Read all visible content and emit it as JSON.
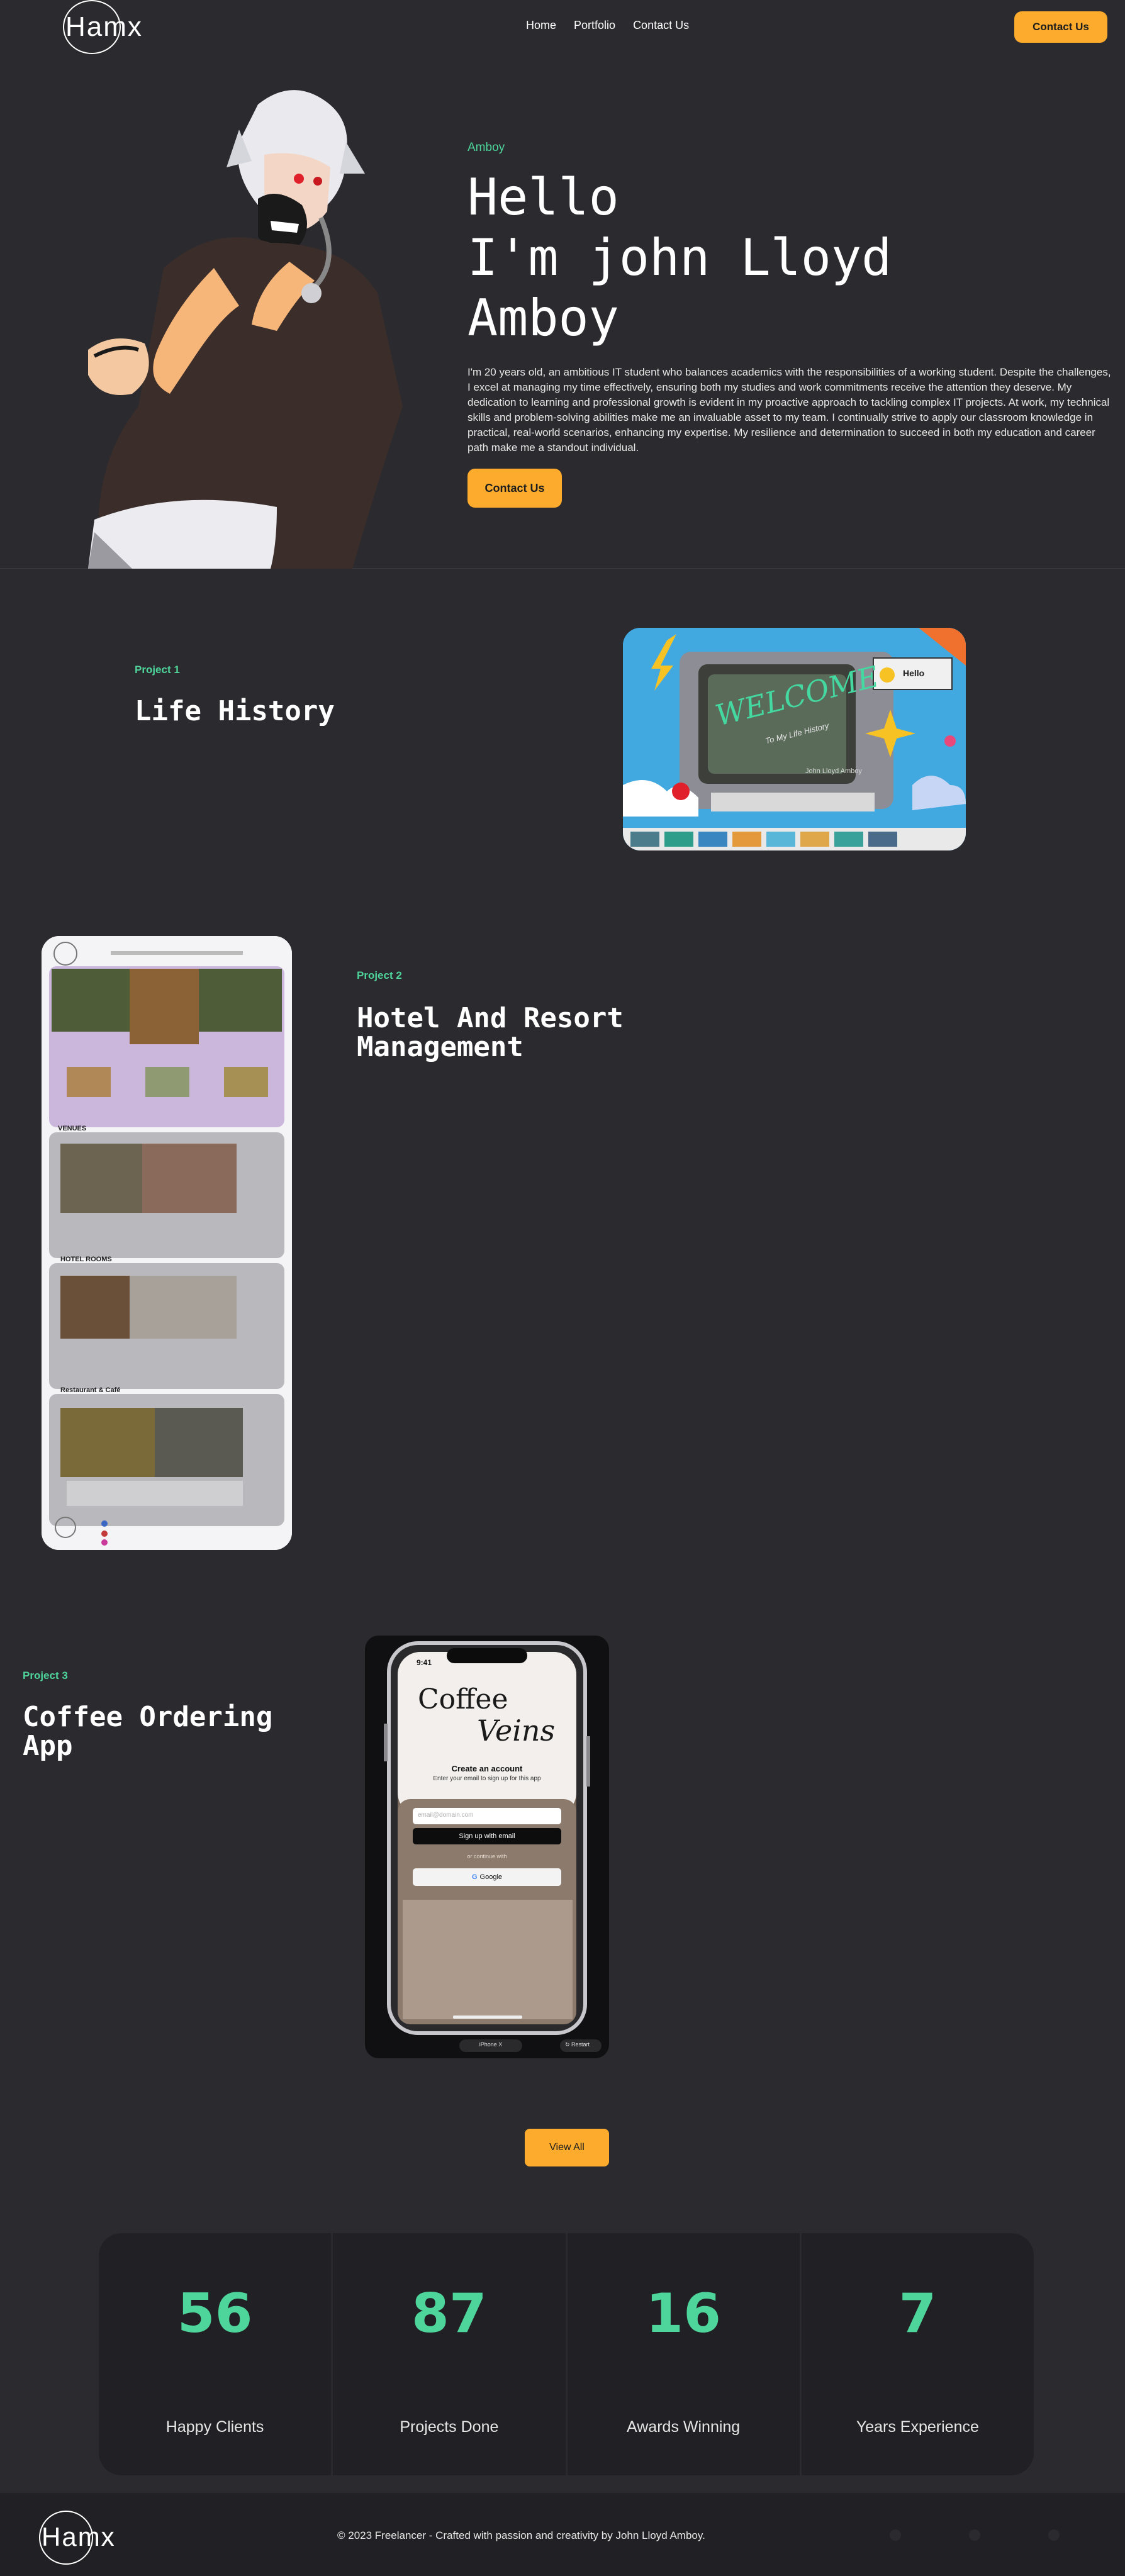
{
  "nav": {
    "logo_text": "Hamx",
    "links": [
      "Home",
      "Portfolio",
      "Contact Us"
    ],
    "cta": "Contact Us"
  },
  "hero": {
    "subtitle": "Amboy",
    "title_lines": [
      "Hello",
      "I'm john Lloyd",
      "Amboy"
    ],
    "description": "I'm 20 years old, an ambitious IT student who balances academics with the responsibilities of a working student. Despite the challenges, I excel at managing my time effectively, ensuring both my studies and work commitments receive the attention they deserve. My dedication to learning and professional growth is evident in my proactive approach to tackling complex IT projects. At work, my technical skills and problem-solving abilities make me an invaluable asset to my team. I continually strive to apply our classroom knowledge in practical, real-world scenarios, enhancing my expertise. My resilience and determination to succeed in both my education and career path make me a standout individual.",
    "cta": "Contact Us"
  },
  "projects": [
    {
      "tag": "Project 1",
      "title": "Life History",
      "screen_text": "WELCOME",
      "screen_sub": "To My Life History",
      "screen_name": "John Lloyd Amboy",
      "popup": "Hello"
    },
    {
      "tag": "Project 2",
      "title": "Hotel And Resort Management",
      "sections": [
        "VENUES",
        "HOTEL ROOMS",
        "Restaurant & Café"
      ]
    },
    {
      "tag": "Project 3",
      "title": "Coffee Ordering App",
      "app_name_1": "Coffee",
      "app_name_2": "Veins",
      "time": "9:41",
      "heading": "Create an account",
      "sub": "Enter your email to sign up for this app",
      "email_placeholder": "email@domain.com",
      "signup": "Sign up with email",
      "or": "or continue with",
      "google": "Google",
      "device": "iPhone X",
      "restart": "Restart"
    }
  ],
  "view_all": "View All",
  "stats": [
    {
      "value": "56",
      "label": "Happy Clients"
    },
    {
      "value": "87",
      "label": "Projects Done"
    },
    {
      "value": "16",
      "label": "Awards Winning"
    },
    {
      "value": "7",
      "label": "Years Experience"
    }
  ],
  "footer": {
    "logo_text": "Hamx",
    "copyright": "© 2023 Freelancer - Crafted with passion and creativity by John Lloyd Amboy."
  },
  "colors": {
    "background": "#2b2b2f",
    "accent": "#fdab2c",
    "highlight": "#4ed59b",
    "panel": "#212125"
  }
}
